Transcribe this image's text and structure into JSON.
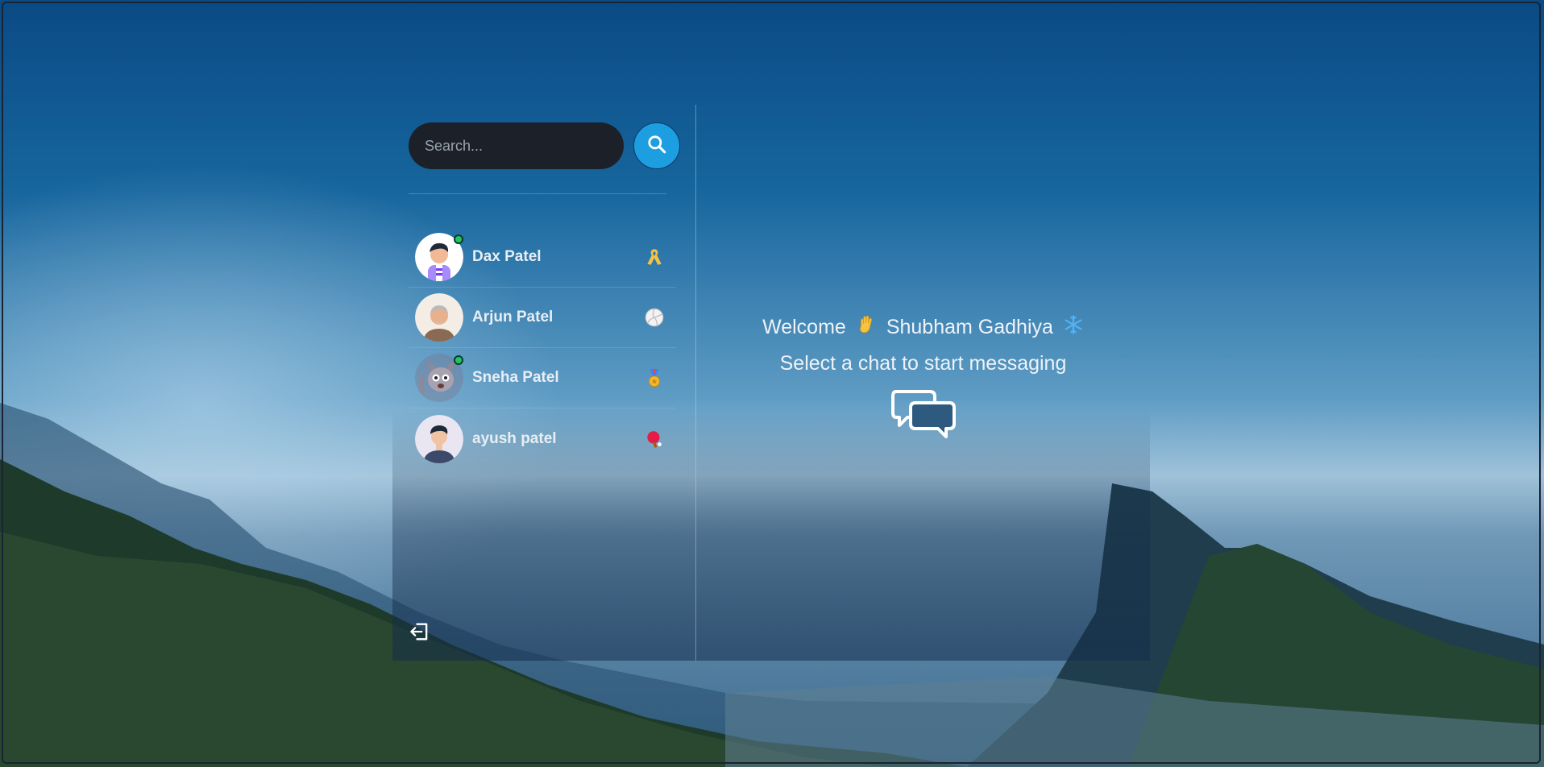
{
  "search": {
    "placeholder": "Search..."
  },
  "conversations": [
    {
      "name": "Dax Patel",
      "online": true,
      "emoji_icon": "yellow-ribbon-icon"
    },
    {
      "name": "Arjun Patel",
      "online": false,
      "emoji_icon": "volleyball-icon"
    },
    {
      "name": "Sneha Patel",
      "online": true,
      "emoji_icon": "medal-icon"
    },
    {
      "name": "ayush patel",
      "online": false,
      "emoji_icon": "ping-pong-icon"
    }
  ],
  "welcome": {
    "greeting": "Welcome",
    "user_name": "Shubham Gadhiya",
    "subtitle": "Select a chat to start messaging"
  },
  "colors": {
    "search_button": "#1d9ee0",
    "search_input_bg": "#1c2129",
    "online": "#22c55e",
    "text": "#eef3f8"
  }
}
